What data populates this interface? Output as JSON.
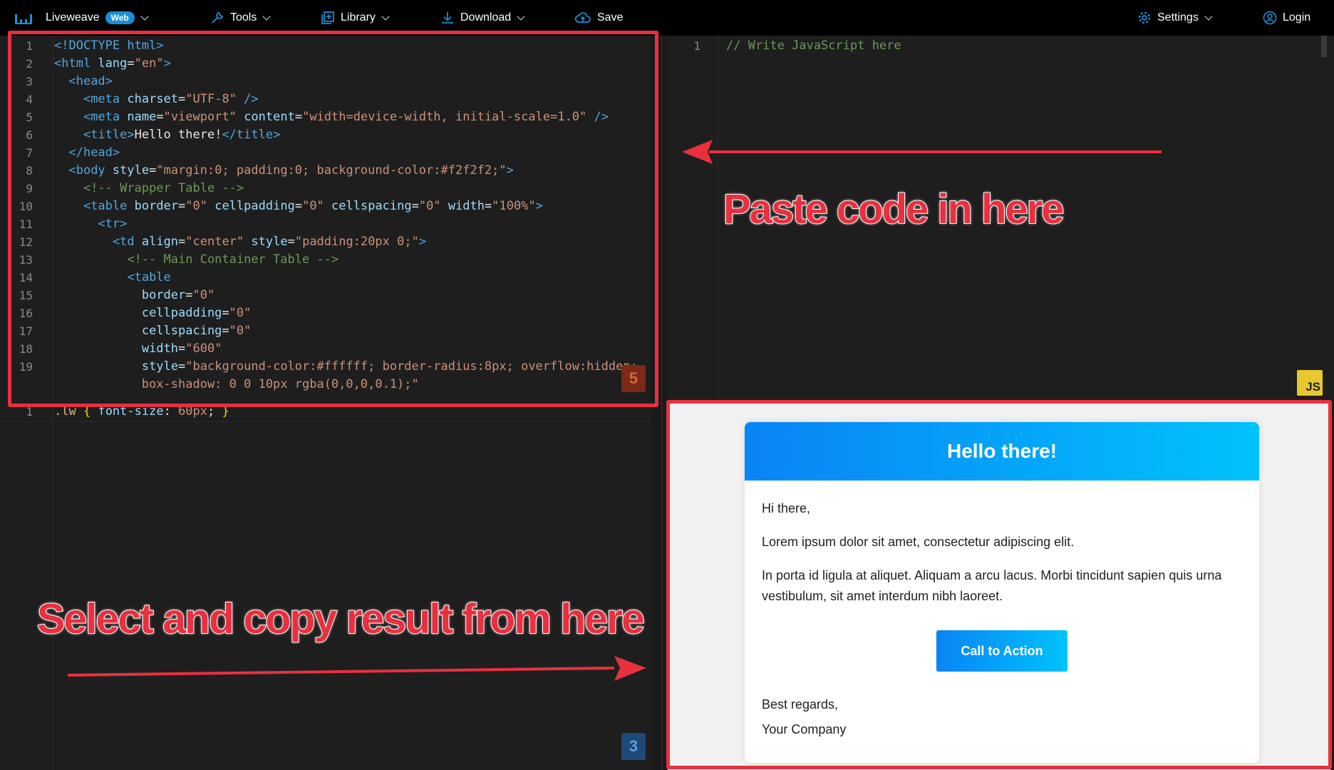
{
  "topbar": {
    "brand": "Liveweave",
    "badge": "Web",
    "tools": "Tools",
    "library": "Library",
    "download": "Download",
    "save": "Save",
    "settings": "Settings",
    "login": "Login"
  },
  "html_editor": {
    "line_numbers": [
      "1",
      "2",
      "3",
      "4",
      "5",
      "6",
      "7",
      "8",
      "9",
      "10",
      "11",
      "12",
      "13",
      "14",
      "15",
      "16",
      "17",
      "18",
      "19"
    ],
    "icon_label": "5"
  },
  "css_editor": {
    "line_numbers": [
      "1"
    ],
    "icon_label": "3"
  },
  "js_editor": {
    "line_numbers": [
      "1"
    ],
    "comment": "// Write JavaScript here",
    "icon_label": "JS"
  },
  "preview": {
    "header": "Hello there!",
    "greeting": "Hi there,",
    "para1": "Lorem ipsum dolor sit amet, consectetur adipiscing elit.",
    "para2": "In porta id ligula at aliquet. Aliquam a arcu lacus. Morbi tincidunt sapien quis urna vestibulum, sit amet interdum nibh laoreet.",
    "cta": "Call to Action",
    "signoff": "Best regards,",
    "company": "Your Company"
  },
  "annotations": {
    "paste": "Paste code in here",
    "copy": "Select and copy result from here"
  },
  "colors": {
    "annotation_red": "#e8303f",
    "accent_blue": "#1a8fd6",
    "gradient_start": "#0a84f6",
    "gradient_end": "#00c2fb"
  }
}
